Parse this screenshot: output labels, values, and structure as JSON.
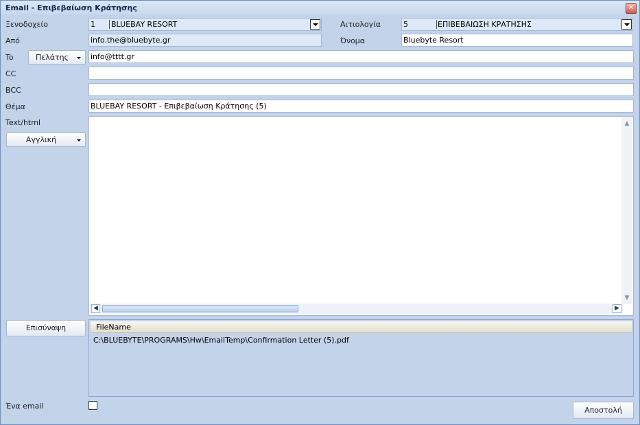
{
  "window": {
    "title": "Email - Επιβεβαίωση Κράτησης"
  },
  "form": {
    "hotel_label": "Ξενοδοχείο",
    "hotel_code": "1",
    "hotel_name": "BLUEBAY RESORT",
    "reason_label": "Αιτιολογία",
    "reason_code": "5",
    "reason_name": "ΕΠΙΒΕΒΑΙΩΣΗ ΚΡΑΤΗΣΗΣ",
    "from_label": "Από",
    "from_value": "info.the@bluebyte.gr",
    "name_label": "Όνομα",
    "name_value": "Bluebyte Resort",
    "to_label": "To",
    "to_type_button": "Πελάτης",
    "to_value": "info@tttt.gr",
    "cc_label": "CC",
    "cc_value": "",
    "bcc_label": "BCC",
    "bcc_value": "",
    "subject_label": "Θέμα",
    "subject_value": "BLUEBAY RESORT - Επιβεβαίωση Κράτησης (5)",
    "body_label": "Text/html",
    "language_button": "Αγγλική",
    "attach_button": "Επισύναψη",
    "attachments_header": "FileName",
    "attachments": [
      "C:\\BLUEBYTE\\PROGRAMS\\Hw\\EmailTemp\\Confirmation Letter (5).pdf"
    ],
    "single_email_label": "Ένα email",
    "single_email_checked": false,
    "send_button": "Αποστολή"
  }
}
